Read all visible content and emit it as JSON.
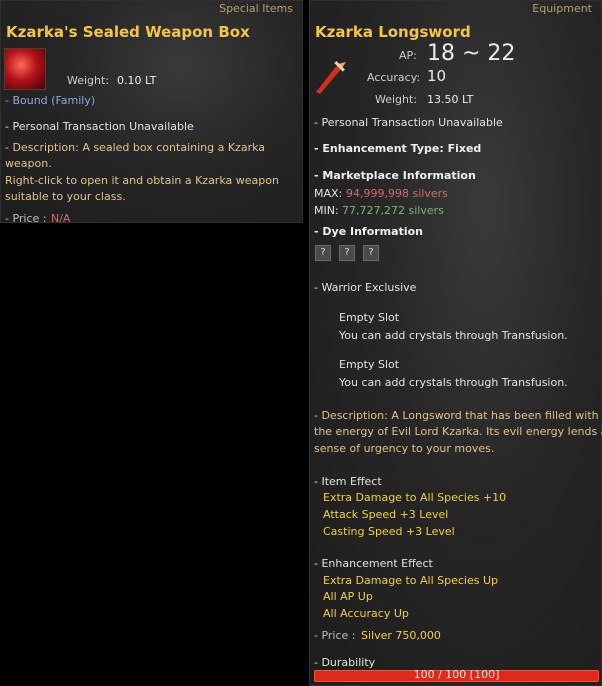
{
  "left_tooltip": {
    "category": "Special Items",
    "title": "Kzarka's Sealed Weapon Box",
    "weight_label": "Weight:",
    "weight_value": "0.10 LT",
    "bound": "- Bound (Family)",
    "transaction": "- Personal Transaction Unavailable",
    "description_lines": [
      "- Description: A sealed box containing a Kzarka",
      "weapon.",
      "Right-click to open it and obtain a Kzarka weapon",
      "suitable to your class."
    ],
    "price_label": "- Price :",
    "price_value": "N/A"
  },
  "right_tooltip": {
    "category": "Equipment",
    "title": "Kzarka Longsword",
    "ap_label": "AP:",
    "ap_value": "18 ~ 22",
    "accuracy_label": "Accuracy:",
    "accuracy_value": "10",
    "weight_label": "Weight:",
    "weight_value": "13.50 LT",
    "transaction": "- Personal Transaction Unavailable",
    "enhancement_type": "- Enhancement Type: Fixed",
    "marketplace_title": "- Marketplace Information",
    "max_label": "MAX:",
    "max_value": "94,999,998 silvers",
    "min_label": "MIN:",
    "min_value": "77,727,272 silvers",
    "dye_title": "- Dye Information",
    "dye_slots": [
      "?",
      "?",
      "?"
    ],
    "class_exclusive": "- Warrior Exclusive",
    "slots": [
      {
        "title": "Empty Slot",
        "text": "You can add crystals through Transfusion."
      },
      {
        "title": "Empty Slot",
        "text": "You can add crystals through Transfusion."
      }
    ],
    "description_lines": [
      "- Description: A Longsword that has been filled with",
      "the energy of Evil Lord Kzarka. Its evil energy lends a",
      "sense of urgency to your moves."
    ],
    "item_effect_title": "- Item Effect",
    "item_effects": [
      "Extra Damage to All Species +10",
      "Attack Speed +3 Level",
      "Casting Speed +3 Level"
    ],
    "enhancement_effect_title": "- Enhancement Effect",
    "enhancement_effects": [
      "Extra Damage to All Species Up",
      "All AP Up",
      "All Accuracy Up"
    ],
    "price_label": "- Price :",
    "price_value": "Silver 750,000",
    "durability_title": "- Durability",
    "durability_text": "100 / 100 [100]",
    "durability_fraction": 1.0
  },
  "colors": {
    "title": "#f2c744",
    "red": "#d26a6a",
    "green": "#7bb37a",
    "yellow": "#f0d23c"
  }
}
